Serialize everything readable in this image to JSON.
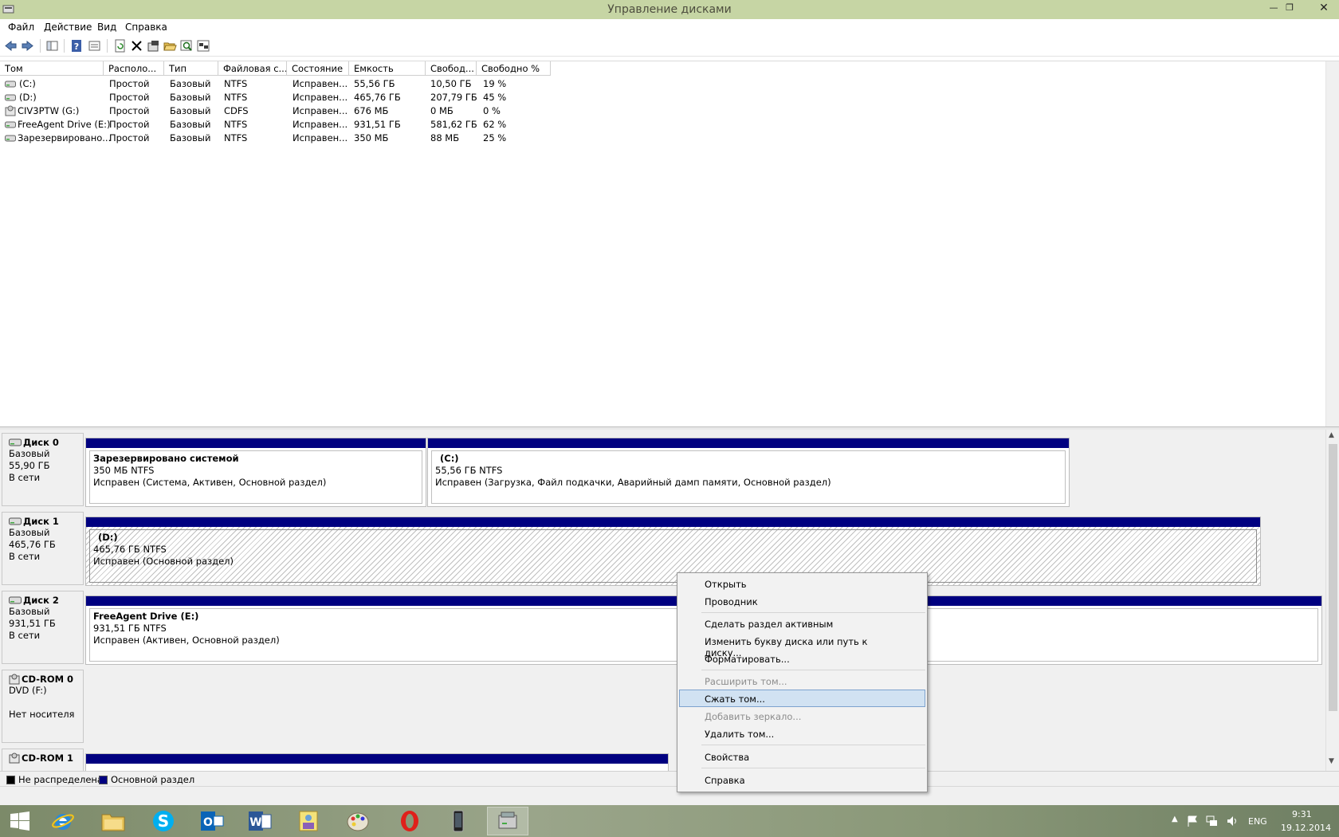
{
  "window": {
    "title": "Управление дисками"
  },
  "menu": [
    "Файл",
    "Действие",
    "Вид",
    "Справка"
  ],
  "volume_list": {
    "columns": [
      "Том",
      "Располо...",
      "Тип",
      "Файловая с...",
      "Состояние",
      "Емкость",
      "Свобод...",
      "Свободно %"
    ],
    "rows": [
      {
        "icon": "drive-icon",
        "tom": "(C:)",
        "loc": "Простой",
        "type": "Базовый",
        "fs": "NTFS",
        "state": "Исправен...",
        "cap": "55,56 ГБ",
        "free": "10,50 ГБ",
        "pct": "19 %"
      },
      {
        "icon": "drive-icon",
        "tom": "(D:)",
        "loc": "Простой",
        "type": "Базовый",
        "fs": "NTFS",
        "state": "Исправен...",
        "cap": "465,76 ГБ",
        "free": "207,79 ГБ",
        "pct": "45 %"
      },
      {
        "icon": "cd-icon",
        "tom": "CIV3PTW (G:)",
        "loc": "Простой",
        "type": "Базовый",
        "fs": "CDFS",
        "state": "Исправен...",
        "cap": "676 МБ",
        "free": "0 МБ",
        "pct": "0 %"
      },
      {
        "icon": "drive-icon",
        "tom": "FreeAgent Drive (E:)",
        "loc": "Простой",
        "type": "Базовый",
        "fs": "NTFS",
        "state": "Исправен...",
        "cap": "931,51 ГБ",
        "free": "581,62 ГБ",
        "pct": "62 %"
      },
      {
        "icon": "drive-icon",
        "tom": "Зарезервировано...",
        "loc": "Простой",
        "type": "Базовый",
        "fs": "NTFS",
        "state": "Исправен...",
        "cap": "350 МБ",
        "free": "88 МБ",
        "pct": "25 %"
      }
    ]
  },
  "disks": [
    {
      "name": "Диск 0",
      "kind": "Базовый",
      "size": "55,90 ГБ",
      "status": "В сети",
      "parts": [
        {
          "title": "Зарезервировано системой",
          "size": "350 МБ NTFS",
          "state": "Исправен (Система, Активен, Основной раздел)"
        },
        {
          "title": "(C:)",
          "size": "55,56 ГБ NTFS",
          "state": "Исправен (Загрузка, Файл подкачки, Аварийный дамп памяти, Основной раздел)"
        }
      ]
    },
    {
      "name": "Диск 1",
      "kind": "Базовый",
      "size": "465,76 ГБ",
      "status": "В сети",
      "parts": [
        {
          "title": "(D:)",
          "size": "465,76 ГБ NTFS",
          "state": "Исправен (Основной раздел)"
        }
      ]
    },
    {
      "name": "Диск 2",
      "kind": "Базовый",
      "size": "931,51 ГБ",
      "status": "В сети",
      "parts": [
        {
          "title": "FreeAgent Drive  (E:)",
          "size": "931,51 ГБ NTFS",
          "state": "Исправен (Активен, Основной раздел)"
        }
      ]
    },
    {
      "name": "CD-ROM 0",
      "kind": "DVD (F:)",
      "size": "",
      "status": "Нет носителя",
      "parts": []
    },
    {
      "name": "CD-ROM 1",
      "kind": "",
      "size": "",
      "status": "",
      "parts": []
    }
  ],
  "legend": [
    {
      "label": "Не распределена",
      "color": "#000000"
    },
    {
      "label": "Основной раздел",
      "color": "#000080"
    }
  ],
  "context_menu": {
    "items": [
      {
        "label": "Открыть",
        "state": "normal"
      },
      {
        "label": "Проводник",
        "state": "normal"
      },
      {
        "label": "Сделать раздел активным",
        "state": "normal"
      },
      {
        "label": "Изменить букву диска или путь к диску...",
        "state": "normal"
      },
      {
        "label": "Форматировать...",
        "state": "normal"
      },
      {
        "label": "Расширить том...",
        "state": "disabled"
      },
      {
        "label": "Сжать том...",
        "state": "highlighted"
      },
      {
        "label": "Добавить зеркало...",
        "state": "disabled"
      },
      {
        "label": "Удалить том...",
        "state": "normal"
      },
      {
        "label": "Свойства",
        "state": "normal"
      },
      {
        "label": "Справка",
        "state": "normal"
      }
    ]
  },
  "taskbar": {
    "apps": [
      "start-button",
      "internet-explorer",
      "file-explorer",
      "skype",
      "outlook",
      "word",
      "photo-viewer",
      "paint",
      "opera",
      "phone-app",
      "disk-management"
    ],
    "tray": {
      "lang": "ENG",
      "time": "9:31",
      "date": "19.12.2014"
    }
  },
  "colors": {
    "primary_partition": "#000080",
    "titlebar": "#c6d5a4",
    "highlight": "#d1e2f2"
  }
}
